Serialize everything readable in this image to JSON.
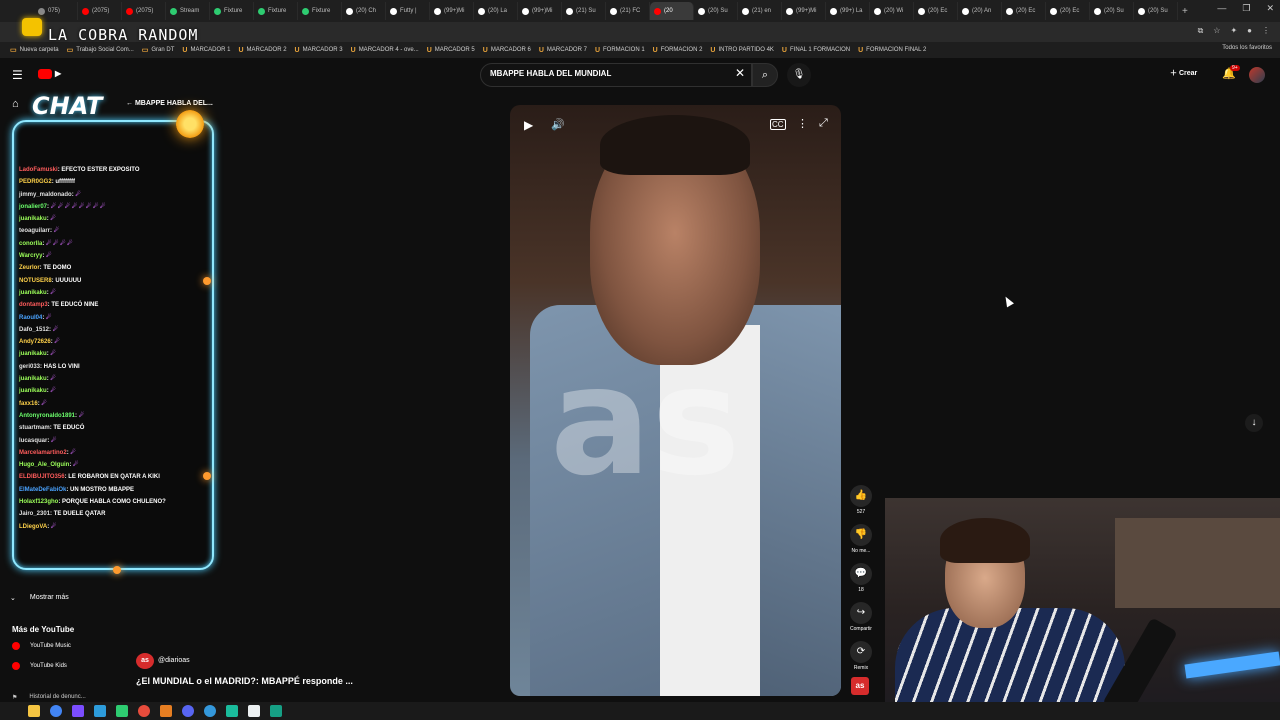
{
  "overlay": {
    "stream_title": "LA COBRA RANDOM",
    "chat_title": "CHAT"
  },
  "browser": {
    "tabs": [
      {
        "label": "075)",
        "color": "#888888"
      },
      {
        "label": "(2075)",
        "color": "#ff0000"
      },
      {
        "label": "(2075)",
        "color": "#ff0000"
      },
      {
        "label": "Stream",
        "color": "#2ecc71"
      },
      {
        "label": "Fixture",
        "color": "#2ecc71"
      },
      {
        "label": "Fixture",
        "color": "#2ecc71"
      },
      {
        "label": "Fixture",
        "color": "#2ecc71"
      },
      {
        "label": "(20) Ch",
        "color": "#ffffff"
      },
      {
        "label": "Futty |",
        "color": "#ffffff"
      },
      {
        "label": "(99+)Mi",
        "color": "#ffffff"
      },
      {
        "label": "(20) La",
        "color": "#ffffff"
      },
      {
        "label": "(99+)Mi",
        "color": "#ffffff"
      },
      {
        "label": "(21) Su",
        "color": "#ffffff"
      },
      {
        "label": "(21) FC",
        "color": "#ffffff"
      },
      {
        "label": "(20",
        "color": "#ff0000"
      },
      {
        "label": "(20) Su",
        "color": "#ffffff"
      },
      {
        "label": "(21) en",
        "color": "#ffffff"
      },
      {
        "label": "(99+)Mi",
        "color": "#ffffff"
      },
      {
        "label": "(99+) La",
        "color": "#ffffff"
      },
      {
        "label": "(20) Wi",
        "color": "#ffffff"
      },
      {
        "label": "(20) Ec",
        "color": "#ffffff"
      },
      {
        "label": "(20) An",
        "color": "#ffffff"
      },
      {
        "label": "(20) Ec",
        "color": "#ffffff"
      },
      {
        "label": "(20) Ec",
        "color": "#ffffff"
      },
      {
        "label": "(20) Su",
        "color": "#ffffff"
      },
      {
        "label": "(20) Su",
        "color": "#ffffff"
      }
    ],
    "active_tab_index": 14,
    "add_tab": "+",
    "window_controls": [
      "—",
      "❐",
      "✕"
    ],
    "bookmarks": [
      "Nueva carpeta",
      "Trabajo Social Com...",
      "Gran DT",
      "MARCADOR 1",
      "MARCADOR 2",
      "MARCADOR 3",
      "MARCADOR 4 - ove...",
      "MARCADOR 5",
      "MARCADOR 6",
      "MARCADOR 7",
      "FORMACION 1",
      "FORMACION 2",
      "INTRO PARTIDO 4K",
      "FINAL 1 FORMACION",
      "FORMACION FINAL 2"
    ],
    "all_favorites": "Todos los favoritos"
  },
  "youtube": {
    "search_query": "MBAPPE HABLA DEL MUNDIAL",
    "create_label": "Crear",
    "bell_badge": "9+",
    "scroll_down_icon": "↓"
  },
  "sidebar": {
    "show_more": "Mostrar más",
    "more_from_youtube": "Más de YouTube",
    "links": [
      "YouTube Music",
      "YouTube Kids"
    ],
    "history_label": "Historial de denunc..."
  },
  "chat": {
    "back_label": "MBAPPE HABLA DEL...",
    "messages": [
      {
        "user": "LadoFamuski",
        "text": ": EFECTO ESTER EXPOSITO",
        "color": "#ff5c5c"
      },
      {
        "user": "PEDR0GG2",
        "text": ": uffffffff",
        "color": "#ffd24a"
      },
      {
        "user": "jimmy_maldonado",
        "text": ":",
        "emotes": "☄",
        "color": "#e0e0e0"
      },
      {
        "user": "jonalier07",
        "text": ":",
        "emotes": "☄ ☄ ☄ ☄ ☄ ☄ ☄ ☄",
        "color": "#6cff6c"
      },
      {
        "user": "juanikaku",
        "text": ":",
        "emotes": "☄",
        "color": "#9cff5a"
      },
      {
        "user": "teoaguilarr",
        "text": ":",
        "emotes": "☄",
        "color": "#e0e0e0"
      },
      {
        "user": "conorlla",
        "text": ":",
        "emotes": "☄ ☄ ☄ ☄",
        "color": "#9cff5a"
      },
      {
        "user": "Warcryy",
        "text": ":",
        "emotes": "☄",
        "color": "#9cff5a"
      },
      {
        "user": "Zeurlor",
        "text": ": TE DOMO",
        "color": "#ffd24a"
      },
      {
        "user": "NOTUSER8",
        "text": ": UUUUUU",
        "color": "#ffd24a"
      },
      {
        "user": "juanikaku",
        "text": ":",
        "emotes": "☄",
        "color": "#9cff5a"
      },
      {
        "user": "dontamp3",
        "text": ": TE EDUCÓ NINE",
        "color": "#ff5c5c"
      },
      {
        "user": "Raoul04",
        "text": ":",
        "emotes": "☄",
        "color": "#4aa3ff"
      },
      {
        "user": "Dafo_1512",
        "text": ":",
        "emotes": "☄",
        "color": "#e0e0e0"
      },
      {
        "user": "Andy72626",
        "text": ":",
        "emotes": "☄",
        "color": "#ffd24a"
      },
      {
        "user": "juanikaku",
        "text": ":",
        "emotes": "☄",
        "color": "#9cff5a"
      },
      {
        "user": "geri033",
        "text": ": HAS LO VINI",
        "color": "#e0e0e0"
      },
      {
        "user": "juanikaku",
        "text": ":",
        "emotes": "☄",
        "color": "#9cff5a"
      },
      {
        "user": "juanikaku",
        "text": ":",
        "emotes": "☄",
        "color": "#9cff5a"
      },
      {
        "user": "faxx16",
        "text": ":",
        "emotes": "☄",
        "color": "#ffd24a"
      },
      {
        "user": "Antonyronaldo1891",
        "text": ":",
        "emotes": "☄",
        "color": "#6cff6c"
      },
      {
        "user": "stuartmam",
        "text": ": TE EDUCÓ",
        "color": "#e0e0e0"
      },
      {
        "user": "lucasquar",
        "text": ":",
        "emotes": "☄",
        "color": "#e0e0e0"
      },
      {
        "user": "Marcelamartino2",
        "text": ":",
        "emotes": "☄",
        "color": "#ff5c5c"
      },
      {
        "user": "Hugo_Ale_Olguin",
        "text": ":",
        "emotes": "☄",
        "color": "#9cff5a"
      },
      {
        "user": "ELDIBUJITO356",
        "text": ": LE ROBARON EN QATAR A KIKI",
        "color": "#ff5c5c"
      },
      {
        "user": "ElMateDeFabiOk",
        "text": ": UN MOSTRO MBAPPE",
        "color": "#4aa3ff"
      },
      {
        "user": "Holaxf123gho",
        "text": ": PORQUE HABLA COMO CHULENO?",
        "color": "#9cff5a"
      },
      {
        "user": "Jairo_2301",
        "text": ": TE DUELE QATAR",
        "color": "#e0e0e0"
      },
      {
        "user": "LDiegoVA",
        "text": ":",
        "emotes": "☄",
        "color": "#ffd24a"
      }
    ]
  },
  "short": {
    "watermark": "as",
    "actions": [
      {
        "icon": "👍",
        "label": "527"
      },
      {
        "icon": "👎",
        "label": "No me..."
      },
      {
        "icon": "💬",
        "label": "18"
      },
      {
        "icon": "↪",
        "label": "Compartir"
      },
      {
        "icon": "⟳",
        "label": "Remix"
      }
    ],
    "channel_handle": "@diarioas",
    "channel_avatar_text": "as",
    "title": "¿El MUNDIAL o el MADRID?: MBAPPÉ responde ..."
  },
  "colors": {
    "youtube_red": "#ff0000",
    "chat_glow": "#4fd0ff",
    "emote_purple": "#d46bff"
  }
}
